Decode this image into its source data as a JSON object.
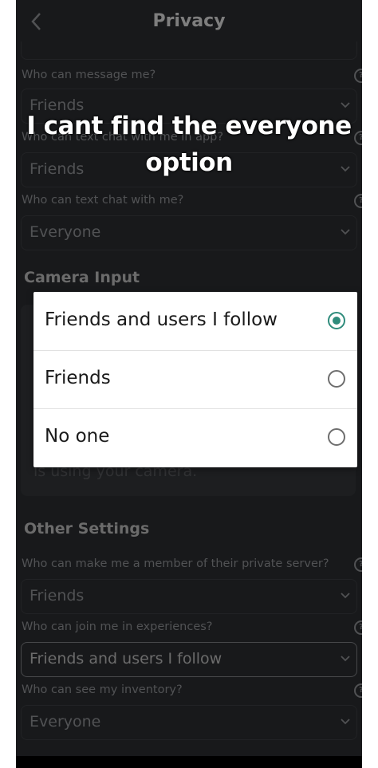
{
  "header": {
    "title": "Privacy",
    "back_icon": "chevron-left-icon"
  },
  "overlay_caption": {
    "line1": "I cant find the everyone",
    "line2": "option"
  },
  "messaging": {
    "message_label": "Who can message me?",
    "message_value": "Friends",
    "app_chat_label": "Who can text chat with me in app?",
    "app_chat_value": "Friends",
    "text_chat_label": "Who can text chat with me?",
    "text_chat_value": "Everyone"
  },
  "camera": {
    "title": "Camera Input",
    "hint_partial": "is using your camera."
  },
  "popup": {
    "options": [
      {
        "label": "Friends and users I follow",
        "selected": true
      },
      {
        "label": "Friends",
        "selected": false
      },
      {
        "label": "No one",
        "selected": false
      }
    ],
    "accent_color": "#2f8c7c"
  },
  "other": {
    "title": "Other Settings",
    "private_server_label": "Who can make me a member of their private server?",
    "private_server_value": "Friends",
    "join_label": "Who can join me in experiences?",
    "join_value": "Friends and users I follow",
    "inventory_label": "Who can see my inventory?",
    "inventory_value": "Everyone"
  },
  "help_glyph": "?"
}
